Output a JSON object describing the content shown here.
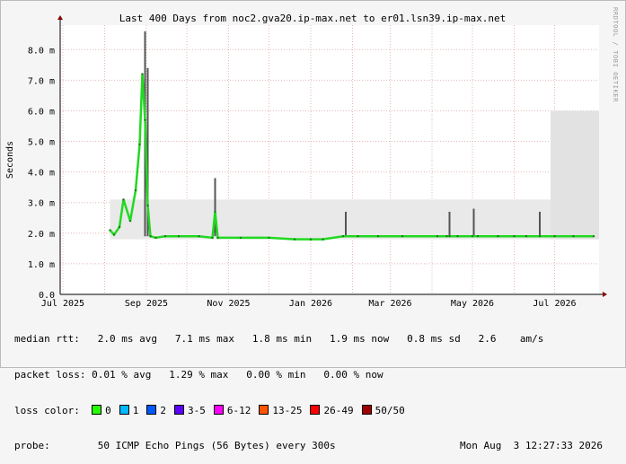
{
  "chart_data": {
    "type": "line",
    "title": "Last 400 Days from noc2.gva20.ip-max.net to er01.lsn39.ip-max.net",
    "ylabel": "Seconds",
    "xlabel": "",
    "ylim": [
      0,
      0.0088
    ],
    "grid": true,
    "side_label": "RRDTOOL / TOBI OETIKER",
    "yticks": [
      {
        "value": 0.0,
        "label": "0.0"
      },
      {
        "value": 0.001,
        "label": "1.0 m"
      },
      {
        "value": 0.002,
        "label": "2.0 m"
      },
      {
        "value": 0.003,
        "label": "3.0 m"
      },
      {
        "value": 0.004,
        "label": "4.0 m"
      },
      {
        "value": 0.005,
        "label": "5.0 m"
      },
      {
        "value": 0.006,
        "label": "6.0 m"
      },
      {
        "value": 0.007,
        "label": "7.0 m"
      },
      {
        "value": 0.008,
        "label": "8.0 m"
      }
    ],
    "xticks": [
      "Jul 2025",
      "Sep 2025",
      "Nov 2025",
      "Jan 2026",
      "Mar 2026",
      "May 2026",
      "Jul 2026"
    ],
    "series": [
      {
        "color": "#21d921",
        "x": [
          "2025-08-05",
          "2025-08-08",
          "2025-08-12",
          "2025-08-15",
          "2025-08-20",
          "2025-08-24",
          "2025-08-27",
          "2025-08-29",
          "2025-08-31",
          "2025-09-02",
          "2025-09-04",
          "2025-09-08",
          "2025-09-15",
          "2025-09-25",
          "2025-10-10",
          "2025-10-20",
          "2025-10-22",
          "2025-10-24",
          "2025-11-10",
          "2025-12-01",
          "2025-12-20",
          "2026-01-01",
          "2026-01-10",
          "2026-01-25",
          "2026-02-05",
          "2026-02-20",
          "2026-03-10",
          "2026-04-05",
          "2026-04-12",
          "2026-04-14",
          "2026-04-20",
          "2026-05-01",
          "2026-05-05",
          "2026-05-20",
          "2026-06-01",
          "2026-06-10",
          "2026-06-20",
          "2026-07-01",
          "2026-07-15",
          "2026-07-30"
        ],
        "values": [
          0.0021,
          0.00195,
          0.0022,
          0.0031,
          0.0024,
          0.0034,
          0.0049,
          0.0072,
          0.0057,
          0.0029,
          0.0019,
          0.00185,
          0.0019,
          0.0019,
          0.0019,
          0.00185,
          0.0027,
          0.00185,
          0.00185,
          0.00185,
          0.0018,
          0.0018,
          0.0018,
          0.0019,
          0.0019,
          0.0019,
          0.0019,
          0.0019,
          0.0019,
          0.0019,
          0.0019,
          0.0019,
          0.0019,
          0.0019,
          0.0019,
          0.0019,
          0.0019,
          0.0019,
          0.0019,
          0.0019
        ]
      }
    ],
    "spikes": [
      {
        "x": "2025-08-31",
        "value": 0.0086
      },
      {
        "x": "2025-09-02",
        "value": 0.0074
      },
      {
        "x": "2025-10-22",
        "value": 0.0038
      },
      {
        "x": "2026-01-27",
        "value": 0.0027
      },
      {
        "x": "2026-04-14",
        "value": 0.0027
      },
      {
        "x": "2026-05-02",
        "value": 0.0028
      },
      {
        "x": "2026-06-20",
        "value": 0.0027
      }
    ],
    "smoke_band": {
      "min": 0.0018,
      "max": 0.0031,
      "high_region": {
        "from": "2026-06-28",
        "to": "2026-08-03",
        "max": 0.006
      }
    }
  },
  "stats": {
    "median_label": "median rtt:",
    "median_value": "2.0 ms avg   7.1 ms max   1.8 ms min   1.9 ms now   0.8 ms sd   2.6    am/s",
    "loss_label": "packet loss:",
    "loss_value": "0.01 % avg   1.29 % max   0.00 % min   0.00 % now",
    "color_label": "loss color:",
    "loss_colors": [
      {
        "label": "0",
        "color": "#26ff00"
      },
      {
        "label": "1",
        "color": "#00b8ff"
      },
      {
        "label": "2",
        "color": "#0059ff"
      },
      {
        "label": "3-5",
        "color": "#5e00ff"
      },
      {
        "label": "6-12",
        "color": "#ff00ff"
      },
      {
        "label": "13-25",
        "color": "#ff5500"
      },
      {
        "label": "26-49",
        "color": "#ff0000"
      },
      {
        "label": "50/50",
        "color": "#a10000"
      }
    ],
    "probe_label": "probe:",
    "probe_value": "50 ICMP Echo Pings (56 Bytes) every 300s",
    "timestamp": "Mon Aug  3 12:27:33 2026"
  }
}
